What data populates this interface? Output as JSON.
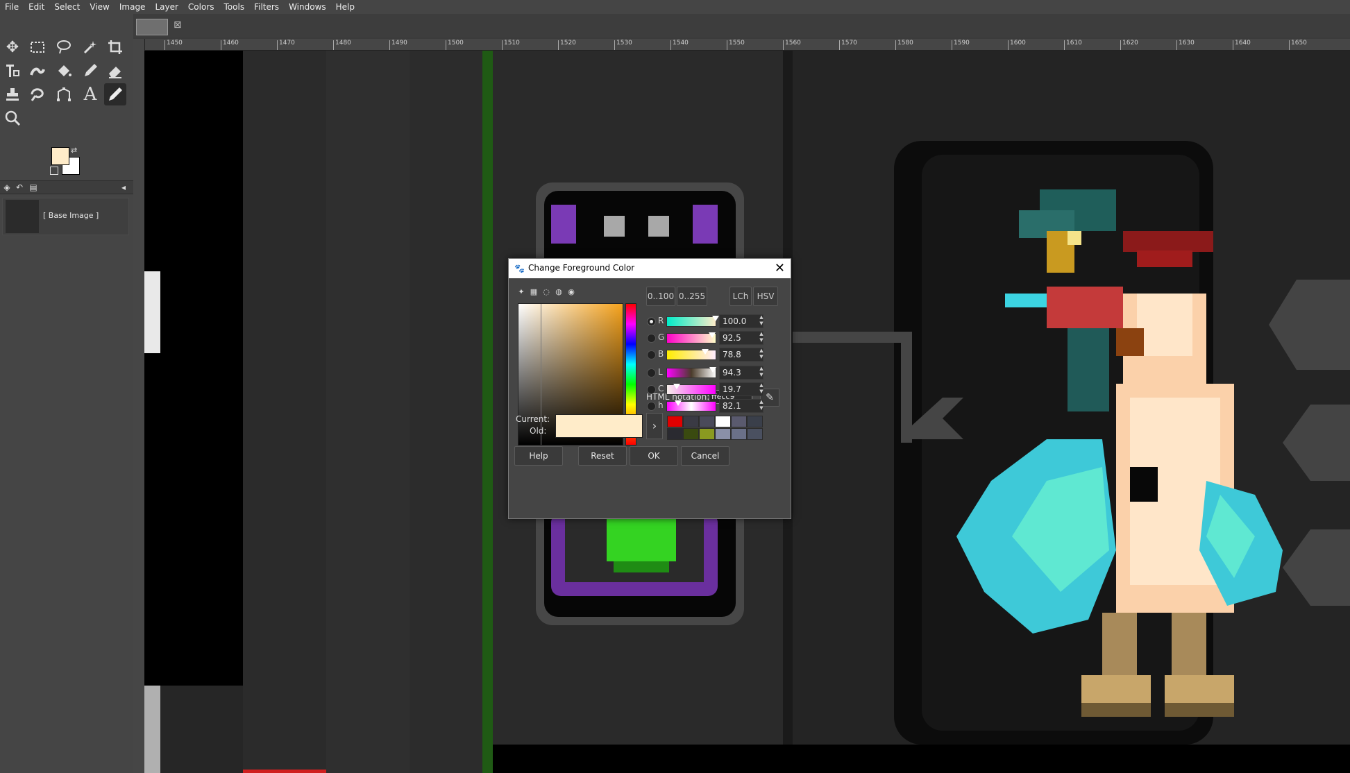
{
  "menubar": [
    "File",
    "Edit",
    "Select",
    "View",
    "Image",
    "Layer",
    "Colors",
    "Tools",
    "Filters",
    "Windows",
    "Help"
  ],
  "layers": {
    "base_name": "[ Base Image ]"
  },
  "ruler": {
    "labels": [
      "1450",
      "1460",
      "1470",
      "1480",
      "1490",
      "1500",
      "1510",
      "1520",
      "1530",
      "1540",
      "1550",
      "1560",
      "1570",
      "1580",
      "1590",
      "1600",
      "1610",
      "1620",
      "1630",
      "1640",
      "1650"
    ]
  },
  "colors": {
    "foreground": "#ffecc9",
    "background": "#ffffff"
  },
  "dialog": {
    "title": "Change Foreground Color",
    "range_100": "0..100",
    "range_255": "0..255",
    "mode_lch": "LCh",
    "mode_hsv": "HSV",
    "channels": [
      {
        "label": "R",
        "value": "100.0",
        "fill": 1.0,
        "gradient": "linear-gradient(to right,#00ecc9,#ffecc9)",
        "selected": true
      },
      {
        "label": "G",
        "value": "92.5",
        "fill": 0.925,
        "gradient": "linear-gradient(to right,#ff00c9,#ffffc9)",
        "selected": false
      },
      {
        "label": "B",
        "value": "78.8",
        "fill": 0.788,
        "gradient": "linear-gradient(to right,#ffec00,#ffecff)",
        "selected": false
      },
      {
        "label": "L",
        "value": "94.3",
        "fill": 0.943,
        "gradient": "linear-gradient(to right,#ff00ff,#4a3b2a,#ffffff)",
        "selected": false
      },
      {
        "label": "C",
        "value": "19.7",
        "fill": 0.197,
        "gradient": "linear-gradient(to right,#f5f0ea,#ff00ff)",
        "selected": false
      },
      {
        "label": "h",
        "value": "82.1",
        "fill": 0.228,
        "gradient": "linear-gradient(to right,#ff00ff,#ffffff,#ff00ff)",
        "selected": false
      }
    ],
    "html_label": "HTML notation:",
    "html_value": "ffecc9",
    "current_label": "Current:",
    "old_label": "Old:",
    "history": [
      "#e00000",
      "#3a3a44",
      "#4a4a5a",
      "#ffffff",
      "#5a5a6e",
      "#3a3f4a",
      "#2a2a30",
      "#3a4a10",
      "#8a9a20",
      "#8a90a8",
      "#6a7088",
      "#4a5060"
    ],
    "help": "Help",
    "reset": "Reset",
    "ok": "OK",
    "cancel": "Cancel"
  }
}
